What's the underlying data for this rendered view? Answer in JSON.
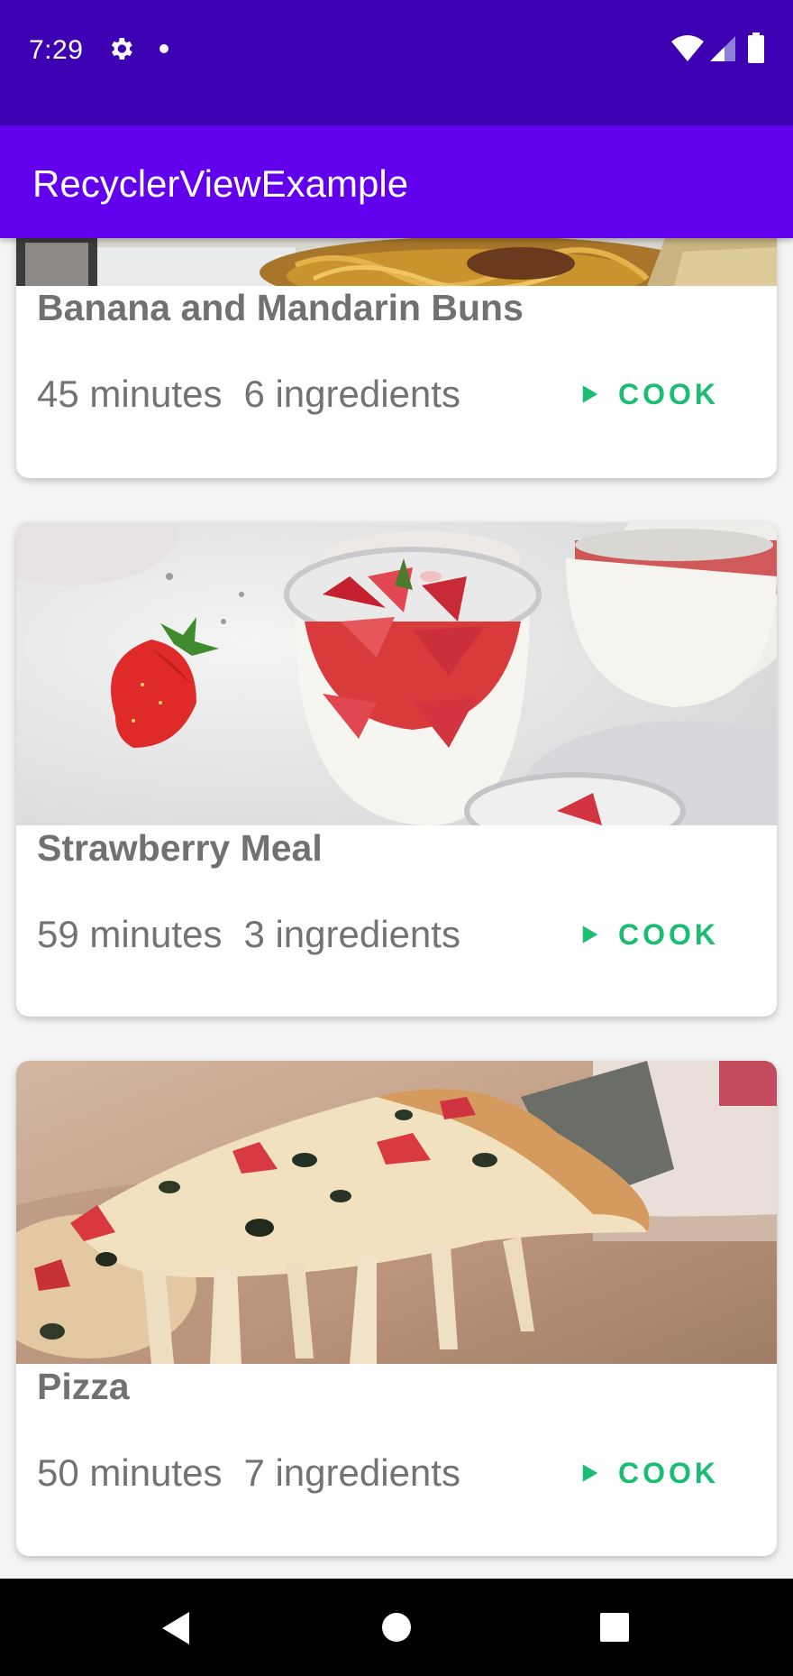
{
  "status_bar": {
    "time": "7:29",
    "icons": [
      "gear-icon",
      "notification-dot",
      "wifi-icon",
      "signal-icon",
      "battery-icon"
    ],
    "background": "#3d00b3"
  },
  "app_bar": {
    "title": "RecyclerViewExample",
    "background": "#6200ee"
  },
  "recipes": [
    {
      "name": "Banana and Mandarin Buns",
      "duration": "45 minutes",
      "ingredients": "6 ingredients",
      "action_label": "COOK",
      "image": "noodles-photo"
    },
    {
      "name": "Strawberry Meal",
      "duration": "59 minutes",
      "ingredients": "3 ingredients",
      "action_label": "COOK",
      "image": "strawberry-yogurt-photo"
    },
    {
      "name": "Pizza",
      "duration": "50 minutes",
      "ingredients": "7 ingredients",
      "action_label": "COOK",
      "image": "pizza-slice-photo"
    }
  ],
  "nav_bar": {
    "buttons": [
      "back-icon",
      "home-icon",
      "recents-icon"
    ]
  },
  "colors": {
    "accent": "#1bbd72",
    "text": "#737373"
  }
}
